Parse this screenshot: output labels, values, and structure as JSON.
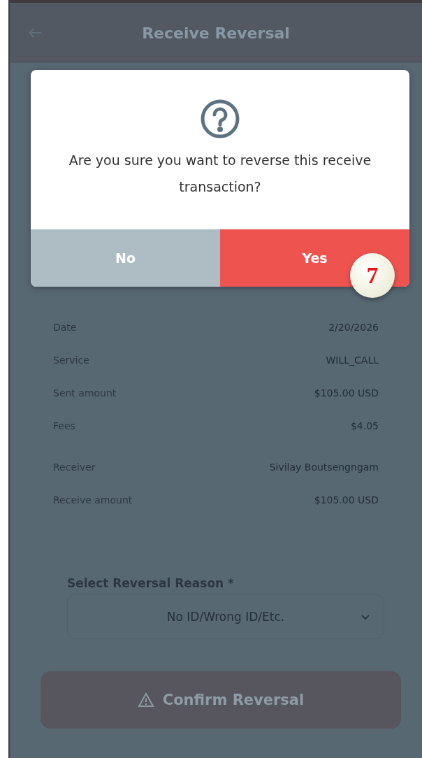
{
  "header": {
    "title": "Receive Reversal"
  },
  "details": [
    {
      "label": "Date",
      "value": "2/20/2026"
    },
    {
      "label": "Service",
      "value": "WILL_CALL"
    },
    {
      "label": "Sent amount",
      "value": "$105.00 USD"
    },
    {
      "label": "Fees",
      "value": "$4.05"
    },
    {
      "label": "Receiver",
      "value": "Sivilay Boutsengngam"
    },
    {
      "label": "Receive amount",
      "value": "$105.00 USD"
    }
  ],
  "reason": {
    "label": "Select Reversal Reason *",
    "value": "No ID/Wrong ID/Etc."
  },
  "confirm_button": {
    "label": "Confirm Reversal",
    "disabled": true
  },
  "dialog": {
    "message": "Are you sure you want to reverse this receive transaction?",
    "buttons": [
      {
        "label": "No",
        "kind": "cancel"
      },
      {
        "label": "Yes",
        "kind": "confirm"
      }
    ]
  },
  "step_badge": "7"
}
